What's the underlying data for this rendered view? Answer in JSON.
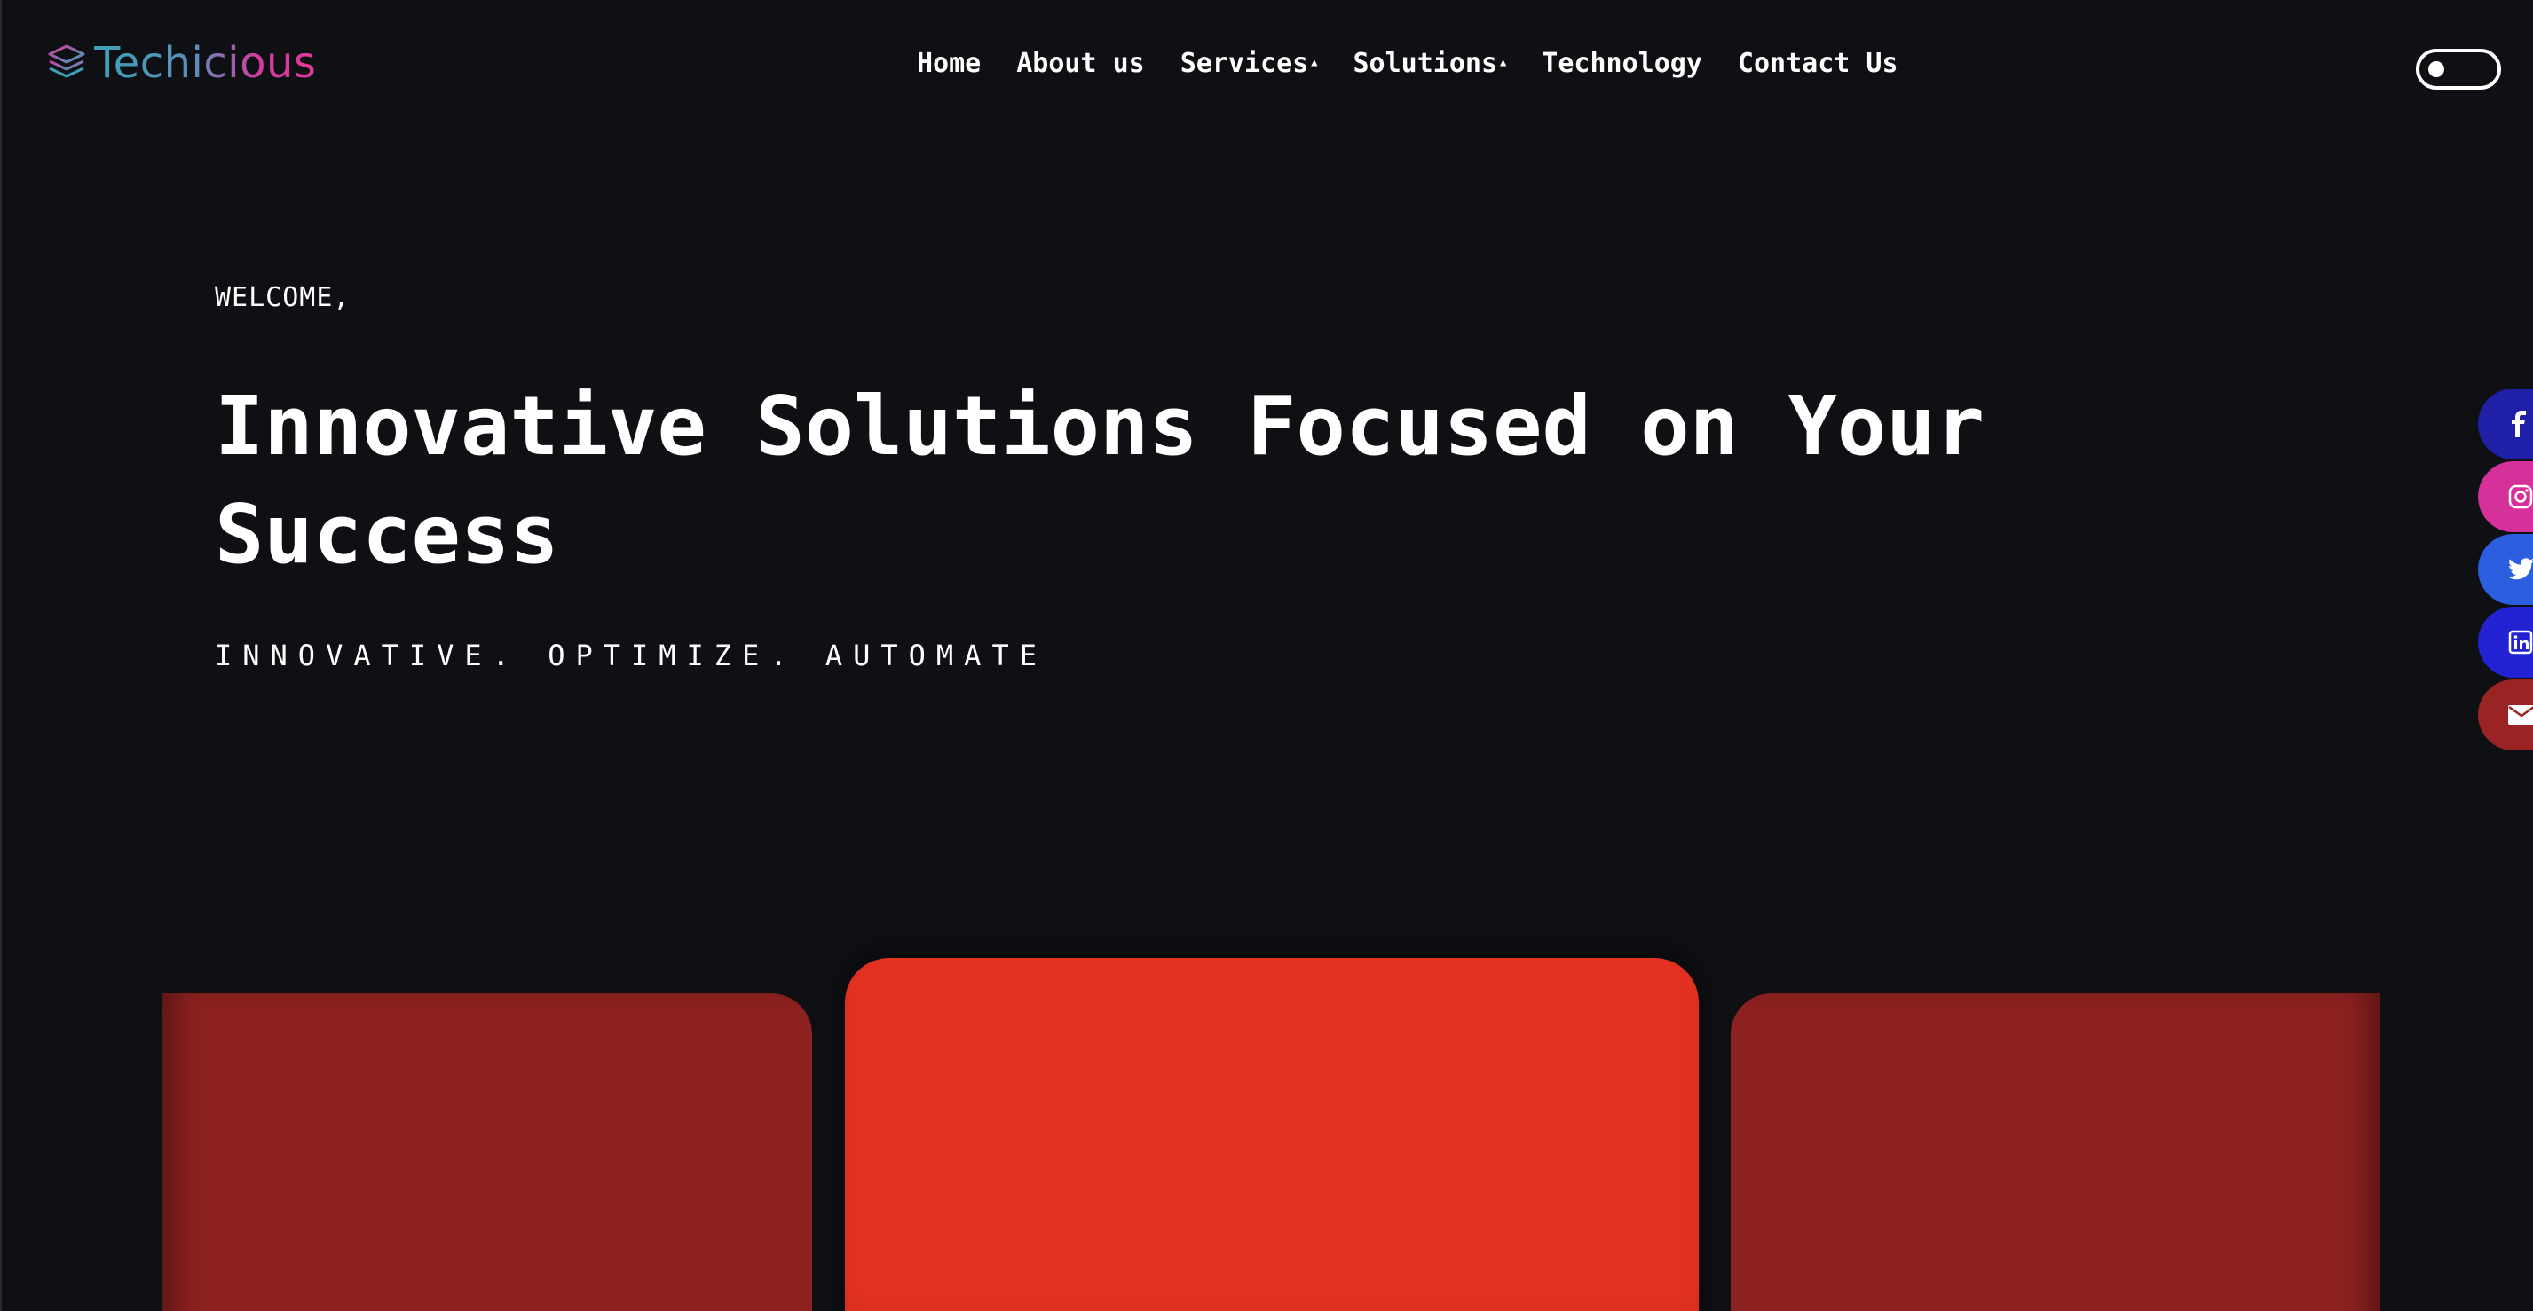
{
  "brand": {
    "name": "Techicious",
    "logo_icon": "layers-icon"
  },
  "nav": {
    "items": [
      {
        "label": "Home",
        "has_dropdown": false
      },
      {
        "label": "About us",
        "has_dropdown": false
      },
      {
        "label": "Services",
        "has_dropdown": true
      },
      {
        "label": "Solutions",
        "has_dropdown": true
      },
      {
        "label": "Technology",
        "has_dropdown": false
      },
      {
        "label": "Contact Us",
        "has_dropdown": false
      }
    ],
    "dropdown_caret": "▲"
  },
  "theme_toggle": {
    "state": "off"
  },
  "hero": {
    "welcome": "WELCOME,",
    "title_line1": "Innovative Solutions Focused on Your",
    "title_line2": "Success",
    "tagline": "INNOVATIVE. OPTIMIZE. AUTOMATE"
  },
  "cards": {
    "colors": {
      "side": "#8e2220",
      "center": "#e43222"
    }
  },
  "social": [
    {
      "name": "facebook",
      "icon": "facebook-icon",
      "color": "#1f1fa8"
    },
    {
      "name": "instagram",
      "icon": "instagram-icon",
      "color": "#d6319a"
    },
    {
      "name": "twitter",
      "icon": "twitter-icon",
      "color": "#2b5fe0"
    },
    {
      "name": "linkedin",
      "icon": "linkedin-icon",
      "color": "#2323d4"
    },
    {
      "name": "email",
      "icon": "envelope-icon",
      "color": "#9a2424"
    }
  ],
  "colors": {
    "background": "#0f1014",
    "text": "#ffffff",
    "logo_gradient_start": "#3aa3b8",
    "logo_gradient_end": "#e0389a"
  }
}
